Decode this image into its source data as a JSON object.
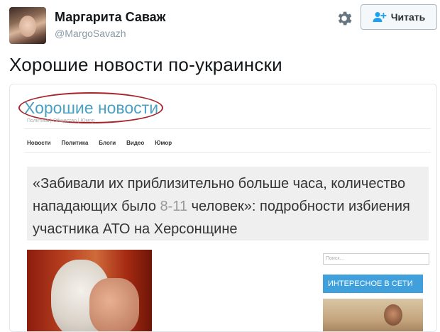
{
  "tweet": {
    "author_name": "Маргарита Саваж",
    "author_handle": "@MargoSavazh",
    "follow_label": "Читать",
    "text": "Хорошие новости по-украински"
  },
  "card": {
    "site_logo": "Хорошие новости",
    "site_subline": "Политика | Общество | Юмор",
    "nav": [
      "Новости",
      "Политика",
      "Блоги",
      "Видео",
      "Юмор"
    ],
    "headline_part1": "«Забивали их приблизительно больше часа, количество нападающих было ",
    "headline_grey": "8-11",
    "headline_part2": " человек»: подробности избиения участника АТО на Херсонщине",
    "search_placeholder": "Поиск...",
    "sidebar_header": "ИНТЕРЕСНОЕ В СЕТИ"
  },
  "colors": {
    "logo_blue": "#4aa0c2",
    "ellipse_red": "#a8252b",
    "sidebar_blue": "#3fa0db"
  }
}
